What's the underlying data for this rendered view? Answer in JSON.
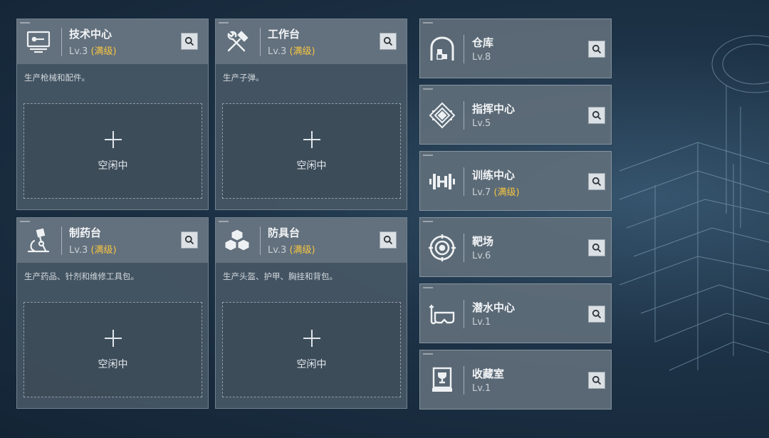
{
  "production": [
    {
      "name": "技术中心",
      "level": "Lv.3",
      "max_tag": "(满级)",
      "desc": "生产枪械和配件。",
      "slot_label": "空闲中",
      "icon": "computer-icon"
    },
    {
      "name": "工作台",
      "level": "Lv.3",
      "max_tag": "(满级)",
      "desc": "生产子弹。",
      "slot_label": "空闲中",
      "icon": "tools-icon"
    },
    {
      "name": "制药台",
      "level": "Lv.3",
      "max_tag": "(满级)",
      "desc": "生产药品、针剂和维修工具包。",
      "slot_label": "空闲中",
      "icon": "microscope-icon"
    },
    {
      "name": "防具台",
      "level": "Lv.3",
      "max_tag": "(满级)",
      "desc": "生产头盔、护甲、胸挂和背包。",
      "slot_label": "空闲中",
      "icon": "armor-blocks-icon"
    }
  ],
  "facilities": [
    {
      "name": "仓库",
      "level": "Lv.8",
      "max_tag": "",
      "icon": "warehouse-icon"
    },
    {
      "name": "指挥中心",
      "level": "Lv.5",
      "max_tag": "",
      "icon": "command-emblem-icon"
    },
    {
      "name": "训练中心",
      "level": "Lv.7",
      "max_tag": "(满级)",
      "icon": "dumbbell-icon"
    },
    {
      "name": "靶场",
      "level": "Lv.6",
      "max_tag": "",
      "icon": "target-icon"
    },
    {
      "name": "潜水中心",
      "level": "Lv.1",
      "max_tag": "",
      "icon": "diving-mask-icon"
    },
    {
      "name": "收藏室",
      "level": "Lv.1",
      "max_tag": "",
      "icon": "trophy-case-icon"
    }
  ],
  "colors": {
    "max_level": "#f5c542",
    "card_body": "#46566a",
    "card_header": "#687682",
    "background": "#1d3246"
  }
}
